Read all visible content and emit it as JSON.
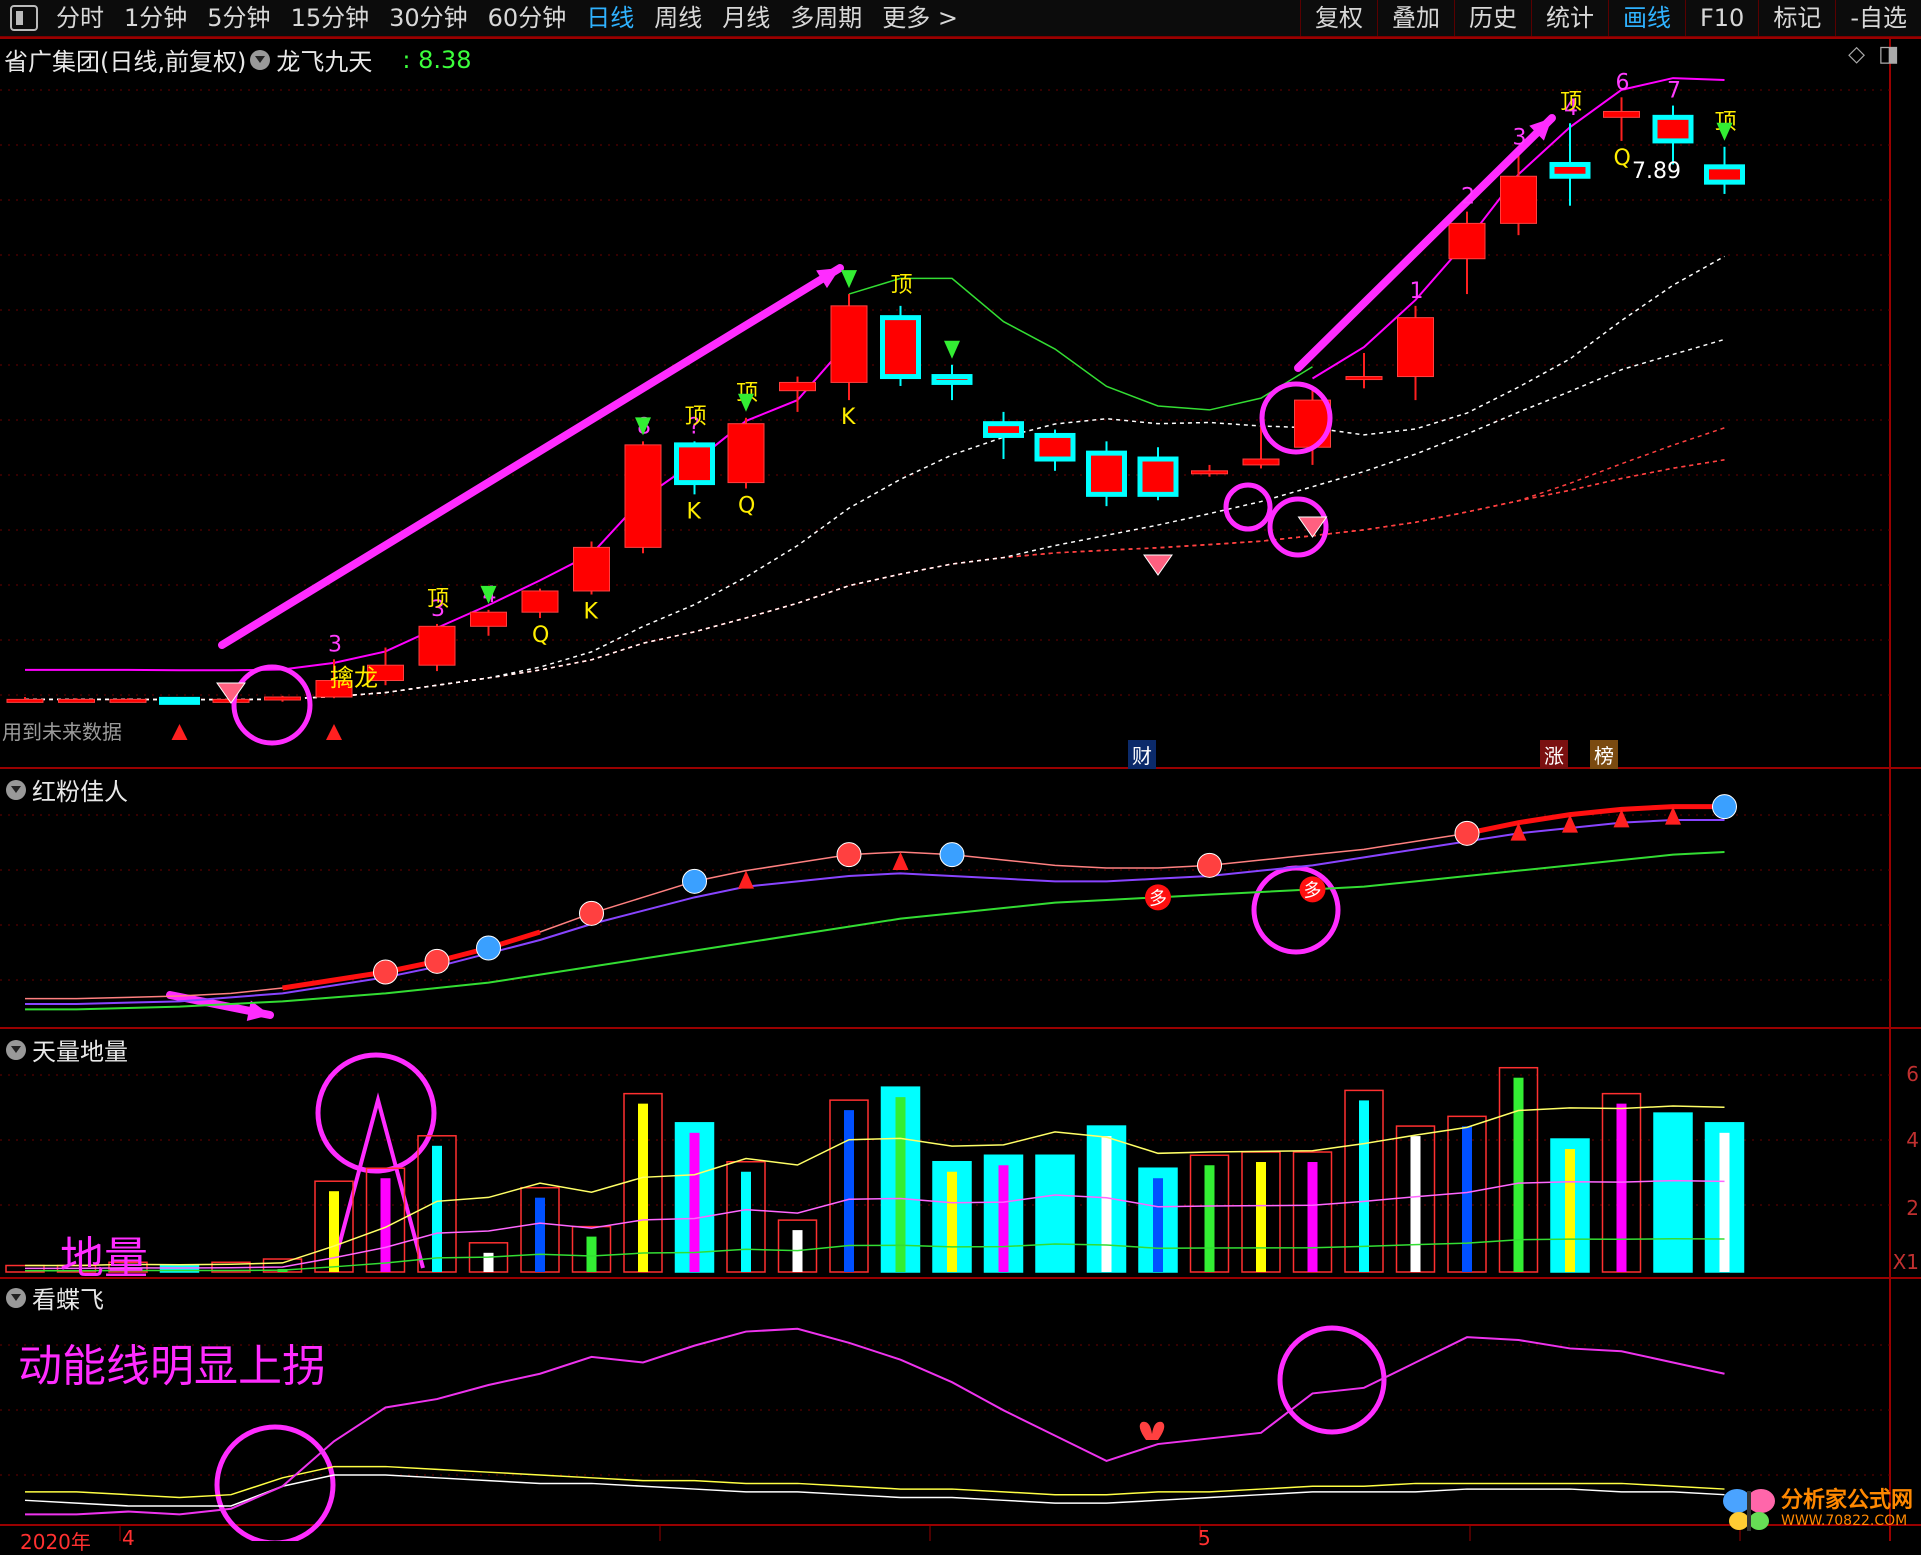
{
  "toolbar": {
    "left": [
      "分时",
      "1分钟",
      "5分钟",
      "15分钟",
      "30分钟",
      "60分钟",
      "日线",
      "周线",
      "月线",
      "多周期",
      "更多 >"
    ],
    "active_index": 6,
    "right": [
      "复权",
      "叠加",
      "历史",
      "统计",
      "画线",
      "F10",
      "标记",
      "-自选"
    ],
    "right_active_index": 4
  },
  "main_pane": {
    "title": "省广集团(日线,前复权)",
    "indicator": "龙飞九天",
    "value": ": 8.38",
    "price_label": "7.89",
    "hint": "用到未来数据",
    "tags": [
      "财",
      "涨",
      "榜"
    ],
    "labels": {
      "top": "顶",
      "q": "Q",
      "k": "K",
      "dragon": "擒龙"
    }
  },
  "pane2": {
    "title": "红粉佳人",
    "tag": "多"
  },
  "pane3": {
    "title": "天量地量",
    "annot": "地量",
    "yticks": [
      "6",
      "4",
      "2"
    ],
    "scale": "X1"
  },
  "pane4": {
    "title": "看蝶飞",
    "annot": "动能线明显上拐"
  },
  "xaxis": {
    "year": "2020年",
    "m4": "4",
    "m5": "5"
  },
  "logo": {
    "text": "分析家公式网",
    "url": "WWW.70822.COM"
  },
  "colors": {
    "up": "#ff0000",
    "down": "#00ffff",
    "ma": "#ff00ff",
    "grid": "#7a0000",
    "annot": "#ff2cff"
  },
  "chart_data": {
    "type": "candlestick",
    "candles": [
      [
        3.85,
        3.88,
        3.84,
        3.86
      ],
      [
        3.86,
        3.87,
        3.85,
        3.86
      ],
      [
        3.86,
        3.87,
        3.85,
        3.86
      ],
      [
        3.86,
        3.88,
        3.84,
        3.85
      ],
      [
        3.85,
        3.88,
        3.84,
        3.86
      ],
      [
        3.86,
        3.89,
        3.84,
        3.88
      ],
      [
        3.88,
        4.2,
        3.87,
        4.02
      ],
      [
        4.02,
        4.3,
        3.98,
        4.15
      ],
      [
        4.15,
        4.5,
        4.1,
        4.48
      ],
      [
        4.48,
        4.62,
        4.4,
        4.6
      ],
      [
        4.6,
        4.8,
        4.55,
        4.78
      ],
      [
        4.78,
        5.2,
        4.75,
        5.15
      ],
      [
        5.15,
        6.05,
        5.1,
        6.02
      ],
      [
        6.02,
        6.05,
        5.6,
        5.7
      ],
      [
        5.7,
        6.25,
        5.65,
        6.2
      ],
      [
        6.48,
        6.6,
        6.3,
        6.55
      ],
      [
        6.55,
        7.3,
        6.4,
        7.2
      ],
      [
        7.1,
        7.2,
        6.52,
        6.6
      ],
      [
        6.6,
        6.7,
        6.4,
        6.55
      ],
      [
        6.2,
        6.3,
        5.9,
        6.1
      ],
      [
        6.1,
        6.15,
        5.8,
        5.9
      ],
      [
        5.95,
        6.05,
        5.5,
        5.6
      ],
      [
        5.9,
        6.0,
        5.55,
        5.6
      ],
      [
        5.8,
        5.85,
        5.75,
        5.8
      ],
      [
        5.85,
        6.3,
        5.82,
        5.9
      ],
      [
        6.0,
        6.5,
        5.85,
        6.4
      ],
      [
        6.6,
        6.8,
        6.5,
        6.6
      ],
      [
        6.6,
        7.2,
        6.4,
        7.1
      ],
      [
        7.6,
        8.0,
        7.3,
        7.9
      ],
      [
        7.9,
        8.5,
        7.8,
        8.3
      ],
      [
        8.4,
        8.75,
        8.05,
        8.3
      ],
      [
        8.8,
        8.97,
        8.6,
        8.85
      ],
      [
        8.8,
        8.9,
        8.4,
        8.6
      ],
      [
        8.38,
        8.55,
        8.15,
        8.25
      ]
    ],
    "pane2_lines": {
      "pink": [
        0.8,
        0.8,
        0.85,
        0.9,
        1.0,
        1.2,
        1.5,
        1.8,
        2.2,
        2.7,
        3.3,
        4.0,
        4.6,
        5.2,
        5.6,
        5.9,
        6.2,
        6.3,
        6.2,
        6.0,
        5.8,
        5.7,
        5.7,
        5.8,
        6.0,
        6.2,
        6.4,
        6.7,
        7.0,
        7.4,
        7.7,
        7.9,
        8.0,
        8.0
      ],
      "purple": [
        0.6,
        0.6,
        0.65,
        0.7,
        0.85,
        1.0,
        1.3,
        1.6,
        2.0,
        2.5,
        3.0,
        3.6,
        4.1,
        4.6,
        5.0,
        5.2,
        5.4,
        5.5,
        5.4,
        5.3,
        5.2,
        5.2,
        5.3,
        5.4,
        5.6,
        5.8,
        6.1,
        6.4,
        6.7,
        7.0,
        7.2,
        7.4,
        7.5,
        7.5
      ],
      "green": [
        0.4,
        0.4,
        0.45,
        0.5,
        0.6,
        0.7,
        0.85,
        1.0,
        1.2,
        1.4,
        1.7,
        2.0,
        2.3,
        2.6,
        2.9,
        3.2,
        3.5,
        3.8,
        4.0,
        4.2,
        4.4,
        4.5,
        4.6,
        4.7,
        4.8,
        4.9,
        5.0,
        5.2,
        5.4,
        5.6,
        5.8,
        6.0,
        6.2,
        6.3
      ]
    },
    "volume": [
      0.2,
      0.2,
      0.3,
      0.2,
      0.3,
      0.4,
      2.8,
      3.2,
      4.2,
      0.9,
      2.6,
      1.4,
      5.5,
      4.6,
      3.4,
      1.6,
      5.3,
      5.7,
      3.4,
      3.6,
      3.6,
      4.5,
      3.2,
      3.6,
      3.7,
      3.7,
      5.6,
      4.5,
      4.8,
      6.3,
      4.1,
      5.5,
      4.9,
      4.6
    ],
    "pane4_lines": {
      "magenta": [
        0.2,
        0.2,
        0.3,
        0.2,
        0.4,
        1.2,
        2.8,
        4.0,
        4.3,
        4.8,
        5.2,
        5.8,
        5.6,
        6.2,
        6.7,
        6.8,
        6.3,
        5.7,
        4.9,
        3.9,
        3.0,
        2.1,
        2.7,
        2.9,
        3.1,
        4.5,
        4.7,
        5.6,
        6.5,
        6.4,
        6.1,
        6.0,
        5.6,
        5.2
      ],
      "yellow": [
        1.0,
        1.0,
        0.9,
        0.8,
        0.9,
        1.5,
        1.9,
        1.9,
        1.8,
        1.7,
        1.6,
        1.5,
        1.4,
        1.4,
        1.3,
        1.3,
        1.2,
        1.1,
        1.1,
        1.0,
        0.9,
        0.9,
        1.0,
        1.0,
        1.1,
        1.2,
        1.2,
        1.3,
        1.3,
        1.3,
        1.3,
        1.3,
        1.2,
        1.1
      ],
      "white": [
        0.7,
        0.6,
        0.5,
        0.5,
        0.5,
        1.2,
        1.6,
        1.6,
        1.5,
        1.4,
        1.3,
        1.3,
        1.2,
        1.1,
        1.0,
        1.0,
        0.9,
        0.8,
        0.8,
        0.7,
        0.6,
        0.6,
        0.7,
        0.8,
        0.9,
        1.0,
        1.0,
        1.0,
        1.1,
        1.1,
        1.1,
        1.0,
        1.0,
        0.9
      ]
    }
  }
}
